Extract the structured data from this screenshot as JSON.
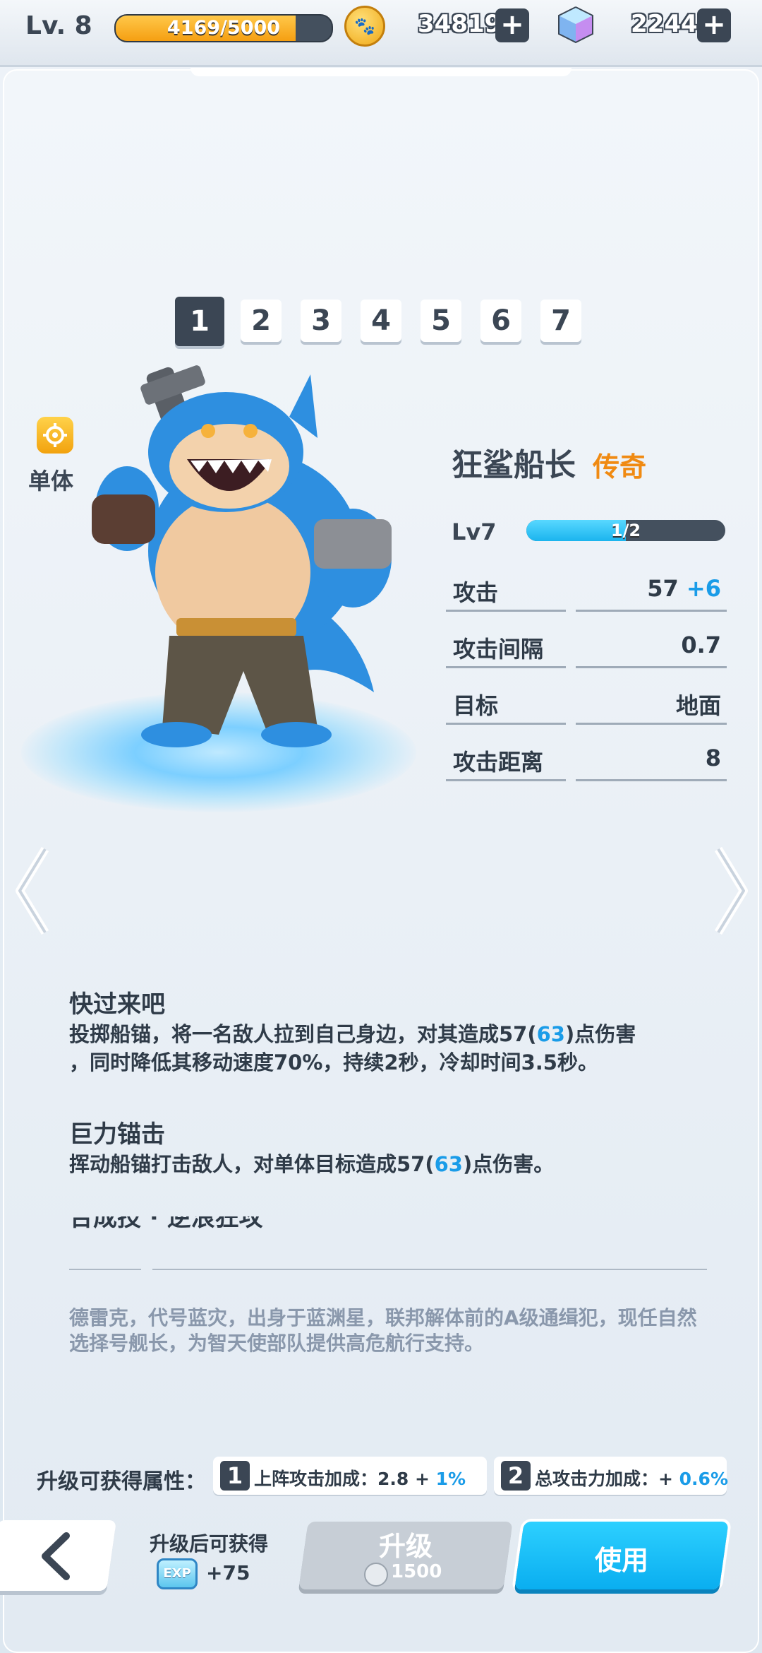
{
  "topbar": {
    "level": "Lv. 8",
    "exp": {
      "current": 4169,
      "max": 5000,
      "label": "4169/5000"
    },
    "coins": "34819",
    "gems": "2244",
    "plus_symbol": "+",
    "coin_icon": "paw-coin-icon",
    "gem_icon": "crystal-cube-icon"
  },
  "level_tabs": [
    "1",
    "2",
    "3",
    "4",
    "5",
    "6",
    "7"
  ],
  "selected_tab": "1",
  "side_badge": {
    "label": "单体",
    "icon": "crosshair-icon"
  },
  "hero": {
    "name": "狂鲨船长",
    "rarity": "传奇",
    "level": "Lv7",
    "cards": {
      "current": 1,
      "max": 2,
      "label": "1/2"
    },
    "stats": [
      {
        "name": "攻击",
        "value": "57",
        "bonus": "+6"
      },
      {
        "name": "攻击间隔",
        "value": "0.7",
        "bonus": ""
      },
      {
        "name": "目标",
        "value": "地面",
        "bonus": ""
      },
      {
        "name": "攻击距离",
        "value": "8",
        "bonus": ""
      }
    ]
  },
  "skills": [
    {
      "title": "快过来吧",
      "desc_a": "投掷船锚，将一名敌人拉到自己身边，对其造成57(",
      "desc_hl": "63",
      "desc_b": ")点伤害",
      "desc_line2": "，同时降低其移动速度70%，持续2秒，冷却时间3.5秒。"
    },
    {
      "title": "巨力锚击",
      "desc_a": "挥动船锚打击敌人，对单体目标造成57(",
      "desc_hl": "63",
      "desc_b": ")点伤害。",
      "desc_line2": ""
    },
    {
      "title": "合成技 · 逆浪狂攻"
    }
  ],
  "lore": "德雷克，代号蓝灾，出身于蓝渊星，联邦解体前的A级通缉犯，现任自然选择号舰长，为智天使部队提供高危航行支持。",
  "upgrade_attrs": {
    "label": "升级可获得属性：",
    "items": [
      {
        "num": "1",
        "text": "上阵攻击加成：2.8 + ",
        "hl": "1%"
      },
      {
        "num": "2",
        "text": "总攻击力加成：+ ",
        "hl": "0.6%"
      }
    ]
  },
  "bottom": {
    "reward_title": "升级后可获得",
    "exp_icon_label": "EXP",
    "reward_value": "+75",
    "upgrade_label": "升级",
    "upgrade_cost": "1500",
    "use_label": "使用"
  }
}
